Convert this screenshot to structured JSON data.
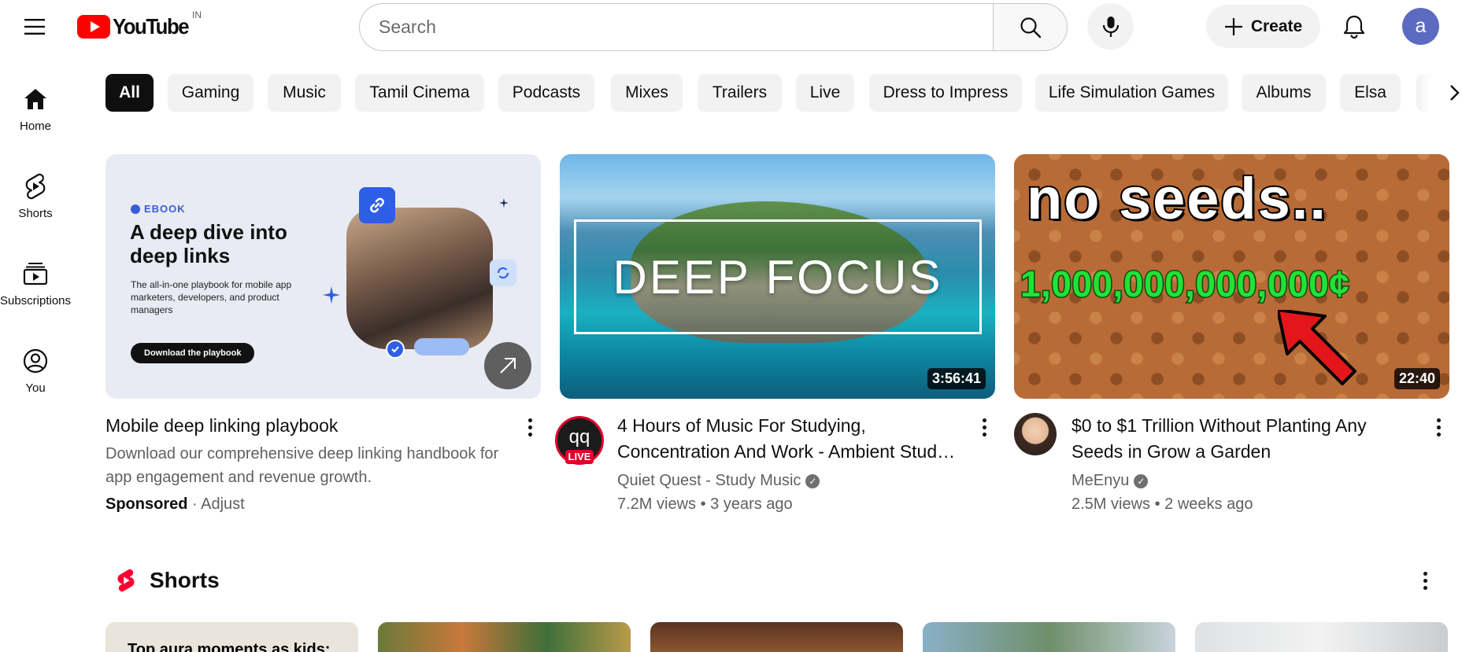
{
  "header": {
    "logo_text": "YouTube",
    "country_code": "IN",
    "search_placeholder": "Search",
    "create_label": "Create",
    "avatar_initial": "a"
  },
  "sidebar": {
    "items": [
      {
        "label": "Home",
        "icon": "home-icon"
      },
      {
        "label": "Shorts",
        "icon": "shorts-icon"
      },
      {
        "label": "Subscriptions",
        "icon": "subscriptions-icon"
      },
      {
        "label": "You",
        "icon": "you-icon"
      }
    ]
  },
  "chips": [
    "All",
    "Gaming",
    "Music",
    "Tamil Cinema",
    "Podcasts",
    "Mixes",
    "Trailers",
    "Live",
    "Dress to Impress",
    "Life Simulation Games",
    "Albums",
    "Elsa"
  ],
  "videos": [
    {
      "type": "ad",
      "title": "Mobile deep linking playbook",
      "description": "Download our comprehensive deep linking handbook for app engagement and revenue growth.",
      "sponsored_label": "Sponsored",
      "advertiser": "Adjust",
      "thumb": {
        "brand": "EBOOK",
        "headline": "A deep dive into deep links",
        "body": "The all-in-one playbook for mobile app marketers, developers, and product managers",
        "cta": "Download the playbook"
      }
    },
    {
      "type": "video",
      "title": "4 Hours of Music For Studying, Concentration And Work - Ambient Stud…",
      "channel": "Quiet Quest - Study Music",
      "verified": true,
      "views": "7.2M views",
      "age": "3 years ago",
      "duration": "3:56:41",
      "channel_initials": "qq",
      "live_label": "LIVE",
      "thumb_text": "DEEP FOCUS"
    },
    {
      "type": "video",
      "title": "$0 to $1 Trillion Without Planting Any Seeds in Grow a Garden",
      "channel": "MeEnyu",
      "verified": true,
      "views": "2.5M views",
      "age": "2 weeks ago",
      "duration": "22:40",
      "thumb_line1": "no seeds..",
      "thumb_line2": "1,000,000,000,000¢"
    }
  ],
  "shorts": {
    "section_title": "Shorts",
    "first_caption": "Top aura moments as kids:"
  },
  "colors": {
    "brand_red": "#ff0000",
    "chip_active_bg": "#0f0f0f",
    "chip_bg": "#f2f2f2",
    "avatar_bg": "#5c6bc0",
    "secondary_text": "#606060"
  }
}
